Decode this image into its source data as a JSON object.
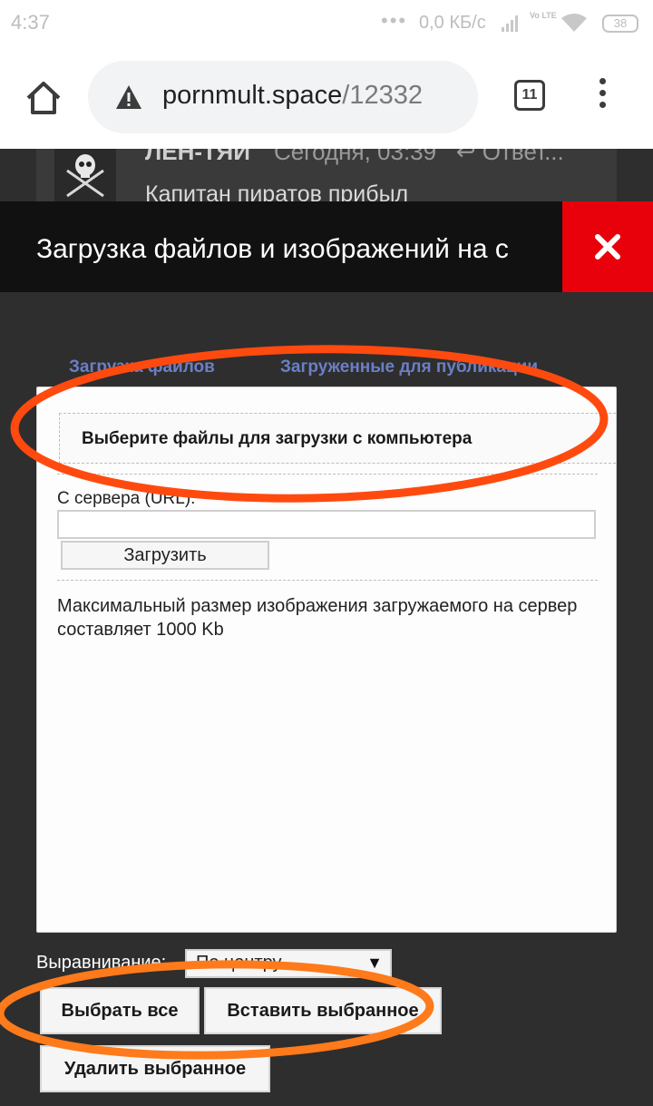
{
  "status_bar": {
    "time": "4:37",
    "dots": "•••",
    "network_speed": "0,0 КБ/с",
    "volte": "Vo LTE",
    "battery": "38"
  },
  "browser": {
    "url_domain": "pornmult.space",
    "url_path": "/12332",
    "tab_count": "11"
  },
  "background_post": {
    "author": "ЛЕН-ТЯИ",
    "meta": "Сегодня, 03:39",
    "reply": "Ответ...",
    "text": "Капитан пиратов прибыл"
  },
  "modal": {
    "title": "Загрузка файлов и изображений на с",
    "close_glyph": "✖",
    "tabs": [
      {
        "label": "Загрузка файлов"
      },
      {
        "label": "Загруженные для публикации"
      }
    ],
    "file_select_label": "Выберите файлы для загрузки с компьютера",
    "server_label": "С сервера (URL):",
    "url_input_value": "",
    "upload_button": "Загрузить",
    "max_size_info": "Максимальный размер изображения загружаемого на сервер составляет 1000 Kb",
    "alignment_label": "Выравнивание:",
    "alignment_value": "По центру",
    "buttons": {
      "select_all": "Выбрать все",
      "insert_selected": "Вставить выбранное",
      "delete_selected": "Удалить выбранное"
    }
  },
  "colors": {
    "close_button": "#e8000b",
    "tab_link": "#6b7fc6",
    "annotation": "#ff4a0f"
  }
}
